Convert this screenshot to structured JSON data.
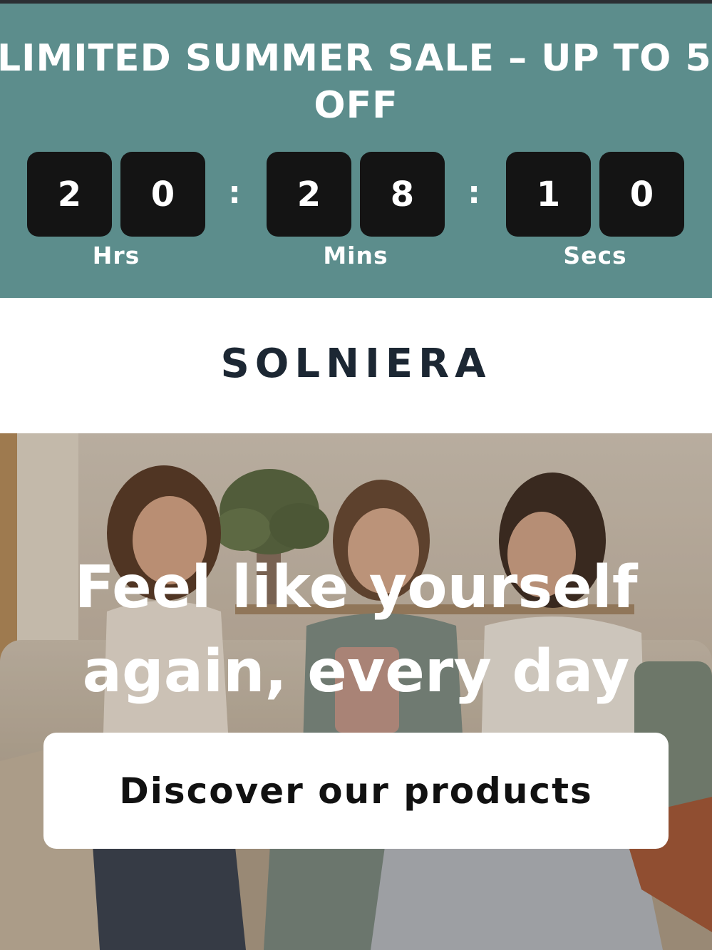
{
  "promo": {
    "title_line1": "LIMITED SUMMER SALE – UP TO 5",
    "title_line2": "OFF",
    "background": "#5c8d8c",
    "countdown": {
      "hours": [
        "2",
        "0"
      ],
      "minutes": [
        "2",
        "8"
      ],
      "seconds": [
        "1",
        "0"
      ],
      "separator": ":",
      "labels": {
        "hours": "Hrs",
        "minutes": "Mins",
        "seconds": "Secs"
      }
    }
  },
  "brand": {
    "name": "SOLNIERA",
    "color": "#1c2733"
  },
  "hero": {
    "headline_line1": "Feel like yourself",
    "headline_line2": "again, every day",
    "cta_label": "Discover our products",
    "image_icon": "photo-three-women-laughing-on-sofa"
  }
}
